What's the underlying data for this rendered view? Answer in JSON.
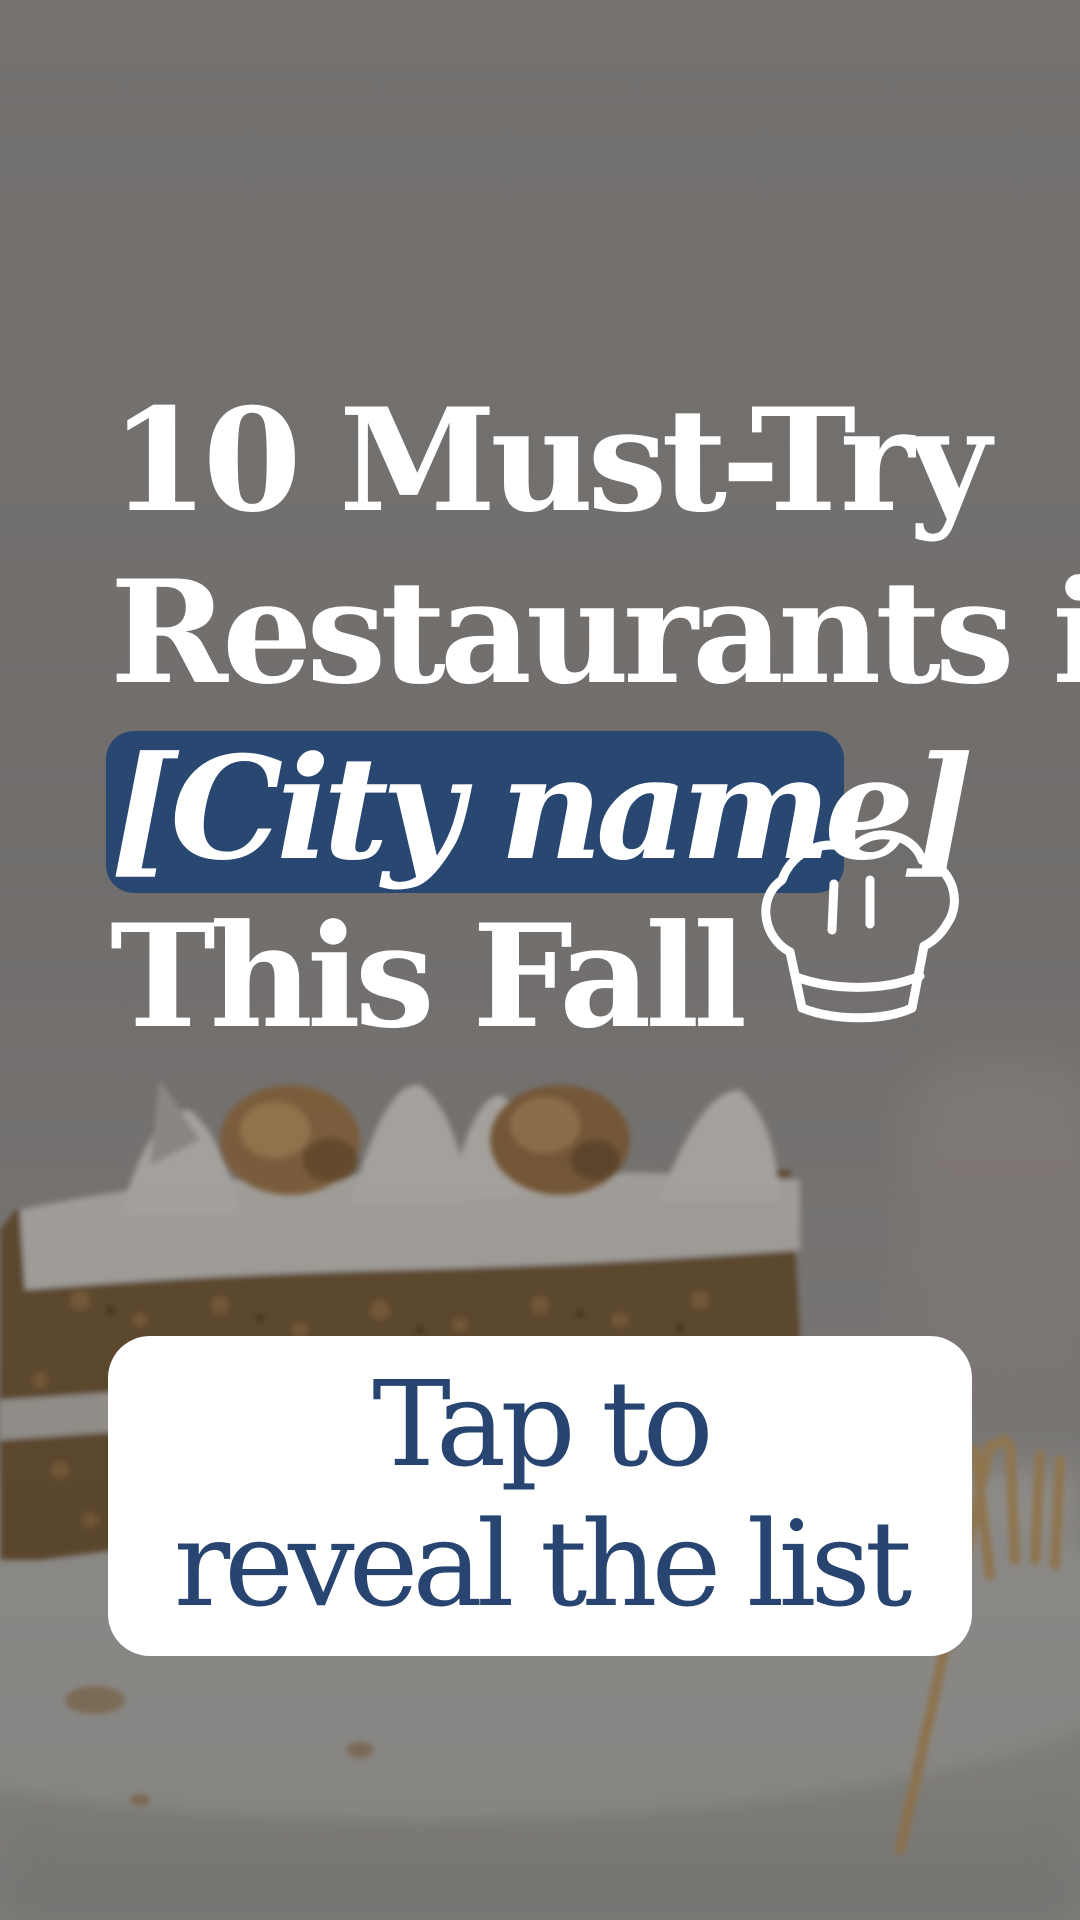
{
  "headline": {
    "line1": "10 Must-Try",
    "line2": "Restaurants in",
    "city": "[City name]",
    "line4": "This Fall"
  },
  "cta": {
    "line1": "Tap to",
    "line2": "reveal the list"
  },
  "colors": {
    "accent": "#284871",
    "headline_text": "#ffffff",
    "cta_text": "#274570",
    "cta_background": "#ffffff"
  },
  "icons": {
    "decoration": "chef-hat-icon"
  }
}
